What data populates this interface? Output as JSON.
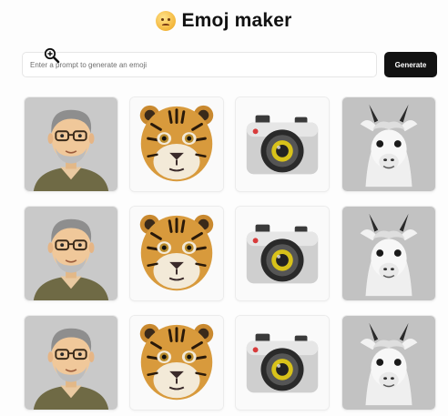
{
  "header": {
    "title": "Emoj maker",
    "logo_icon": "worried-face-icon"
  },
  "prompt": {
    "placeholder": "Enter a prompt to generate an emoji",
    "value": ""
  },
  "generate_button": {
    "label": "Generate"
  },
  "cursor": {
    "icon": "zoom-in-cursor-icon"
  },
  "emoji_grid": {
    "rows": [
      [
        "man-with-glasses",
        "tiger",
        "camera",
        "llama"
      ],
      [
        "man-with-glasses",
        "tiger",
        "camera",
        "llama"
      ],
      [
        "man-with-glasses",
        "tiger",
        "camera",
        "llama"
      ]
    ]
  },
  "colors": {
    "button_bg": "#121212",
    "page_bg": "#fdfdfd",
    "card_border": "#ececec"
  }
}
